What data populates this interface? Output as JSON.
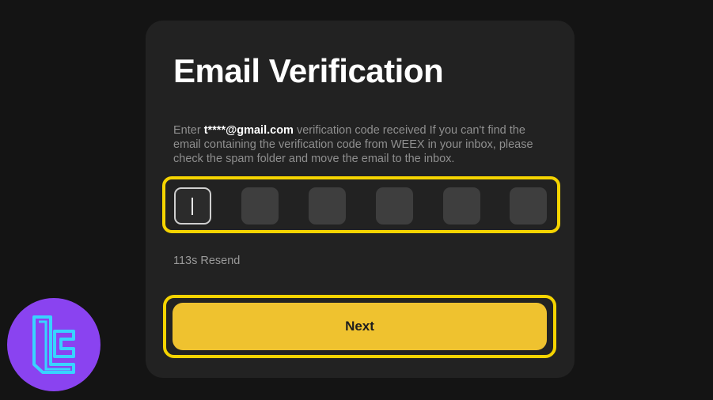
{
  "card": {
    "title": "Email Verification",
    "description": {
      "prefix": "Enter ",
      "email": "t****@gmail.com",
      "suffix": " verification code received If you can't find the email containing the verification code from WEEX in your inbox, please check the spam folder and move the email to the inbox."
    },
    "code_inputs": [
      "",
      "",
      "",
      "",
      "",
      ""
    ],
    "resend_text": "113s Resend",
    "next_label": "Next"
  },
  "logo": {
    "icon": "tc-brand-logo-icon"
  },
  "colors": {
    "background": "#141414",
    "card": "#222222",
    "highlight": "#f5d400",
    "button": "#efc22f",
    "logo": "#8a43f0"
  }
}
